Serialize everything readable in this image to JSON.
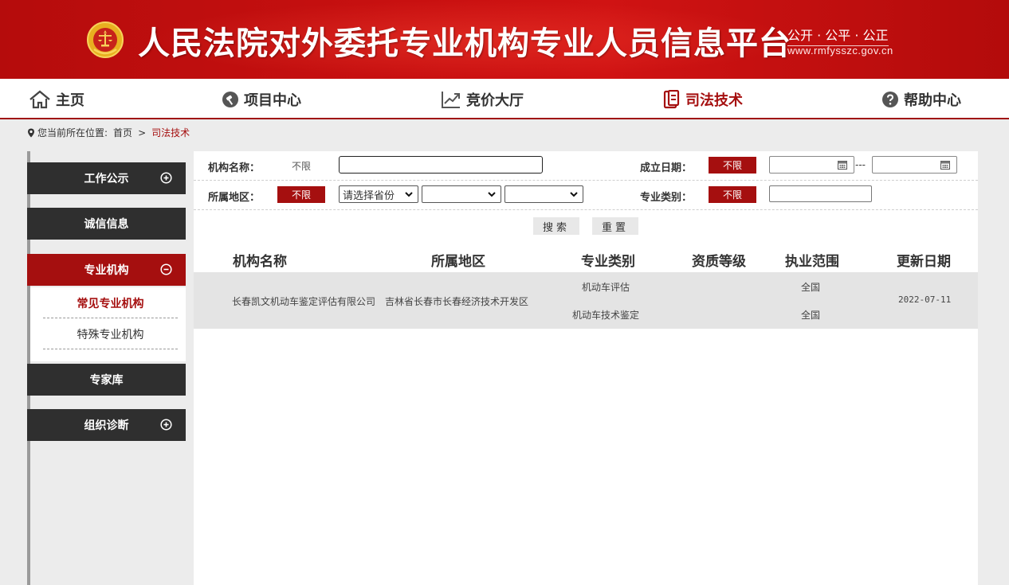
{
  "header": {
    "title": "人民法院对外委托专业机构专业人员信息平台",
    "motto": "公开 · 公平 · 公正",
    "url": "www.rmfysszc.gov.cn",
    "colors": {
      "primary_red": "#a50f0f",
      "dark": "#2f2f2f"
    }
  },
  "nav": {
    "items": [
      {
        "label": "主页",
        "icon": "home-icon"
      },
      {
        "label": "项目中心",
        "icon": "hammer-icon"
      },
      {
        "label": "竞价大厅",
        "icon": "trend-chart-icon"
      },
      {
        "label": "司法技术",
        "icon": "document-icon"
      },
      {
        "label": "帮助中心",
        "icon": "help-icon"
      }
    ],
    "active": "司法技术"
  },
  "breadcrumb": {
    "prefix": "您当前所在位置:",
    "home": "首页",
    "separator": ">",
    "current": "司法技术"
  },
  "sidebar": {
    "items": [
      {
        "label": "工作公示",
        "toggle": "plus"
      },
      {
        "label": "诚信信息"
      },
      {
        "label": "专业机构",
        "toggle": "minus",
        "active": true
      },
      {
        "label": "专家库"
      },
      {
        "label": "组织诊断",
        "toggle": "plus"
      }
    ],
    "subitems": [
      {
        "label": "常见专业机构",
        "active": true
      },
      {
        "label": "特殊专业机构"
      }
    ]
  },
  "filters": {
    "org_name_label": "机构名称：",
    "org_name_value": "不限",
    "found_date_label": "成立日期：",
    "found_date_value": "不限",
    "date_separator": "---",
    "region_label": "所属地区：",
    "region_value": "不限",
    "province_placeholder": "请选择省份",
    "category_label": "专业类别：",
    "category_value": "不限",
    "search_button": "搜索",
    "reset_button": "重置"
  },
  "table": {
    "columns": [
      "机构名称",
      "所属地区",
      "专业类别",
      "资质等级",
      "执业范围",
      "更新日期"
    ],
    "rows": [
      {
        "name": "长春凯文机动车鉴定评估有限公司",
        "region": "吉林省长春市长春经济技术开发区",
        "categories": [
          "机动车评估",
          "机动车技术鉴定"
        ],
        "level": "",
        "scopes": [
          "全国",
          "全国"
        ],
        "updated": "2022-07-11"
      }
    ]
  }
}
